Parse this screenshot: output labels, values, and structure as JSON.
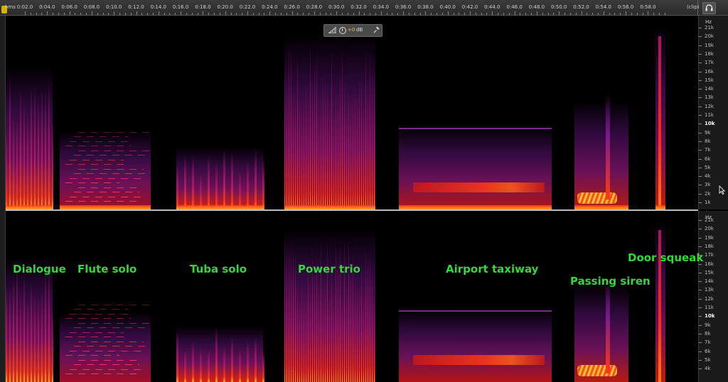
{
  "ruler": {
    "unit": "hms",
    "labels": [
      "0:02.0",
      "0:04.0",
      "0:06.0",
      "0:08.0",
      "0:10.0",
      "0:12.0",
      "0:14.0",
      "0:16.0",
      "0:18.0",
      "0:20.0",
      "0:22.0",
      "0:24.0",
      "0:26.0",
      "0:28.0",
      "0:30.0",
      "0:32.0",
      "0:34.0",
      "0:36.0",
      "0:38.0",
      "0:40.0",
      "0:42.0",
      "0:44.0",
      "0:46.0",
      "0:48.0",
      "0:50.0",
      "0:52.0",
      "0:54.0",
      "0:56.0",
      "0:58.0"
    ],
    "clip_label": "(clip)"
  },
  "hud": {
    "db_value": "+0",
    "db_unit": "dB"
  },
  "scale_top": {
    "unit": "Hz",
    "labels": [
      "21k",
      "20k",
      "19k",
      "18k",
      "17k",
      "16k",
      "15k",
      "14k",
      "13k",
      "12k",
      "11k",
      "10k",
      "9k",
      "8k",
      "7k",
      "6k",
      "5k",
      "4k",
      "3k",
      "2k",
      "1k"
    ]
  },
  "scale_bottom": {
    "unit": "Hz",
    "labels": [
      "21k",
      "20k",
      "19k",
      "18k",
      "17k",
      "16k",
      "15k",
      "14k",
      "13k",
      "12k",
      "11k",
      "10k",
      "9k",
      "8k",
      "7k",
      "6k",
      "5k",
      "4k"
    ]
  },
  "annotations": {
    "dialogue": "Dialogue",
    "flute_solo": "Flute solo",
    "tuba_solo": "Tuba solo",
    "power_trio": "Power trio",
    "airport_taxiway": "Airport taxiway",
    "passing_siren": "Passing siren",
    "door_squeak": "Door squeak"
  },
  "colors": {
    "annotation": "#35d83a",
    "spectrogram_hot": "#ffd23a",
    "spectrogram_mid": "#e0201c",
    "spectrogram_low": "#7a1a8e"
  }
}
